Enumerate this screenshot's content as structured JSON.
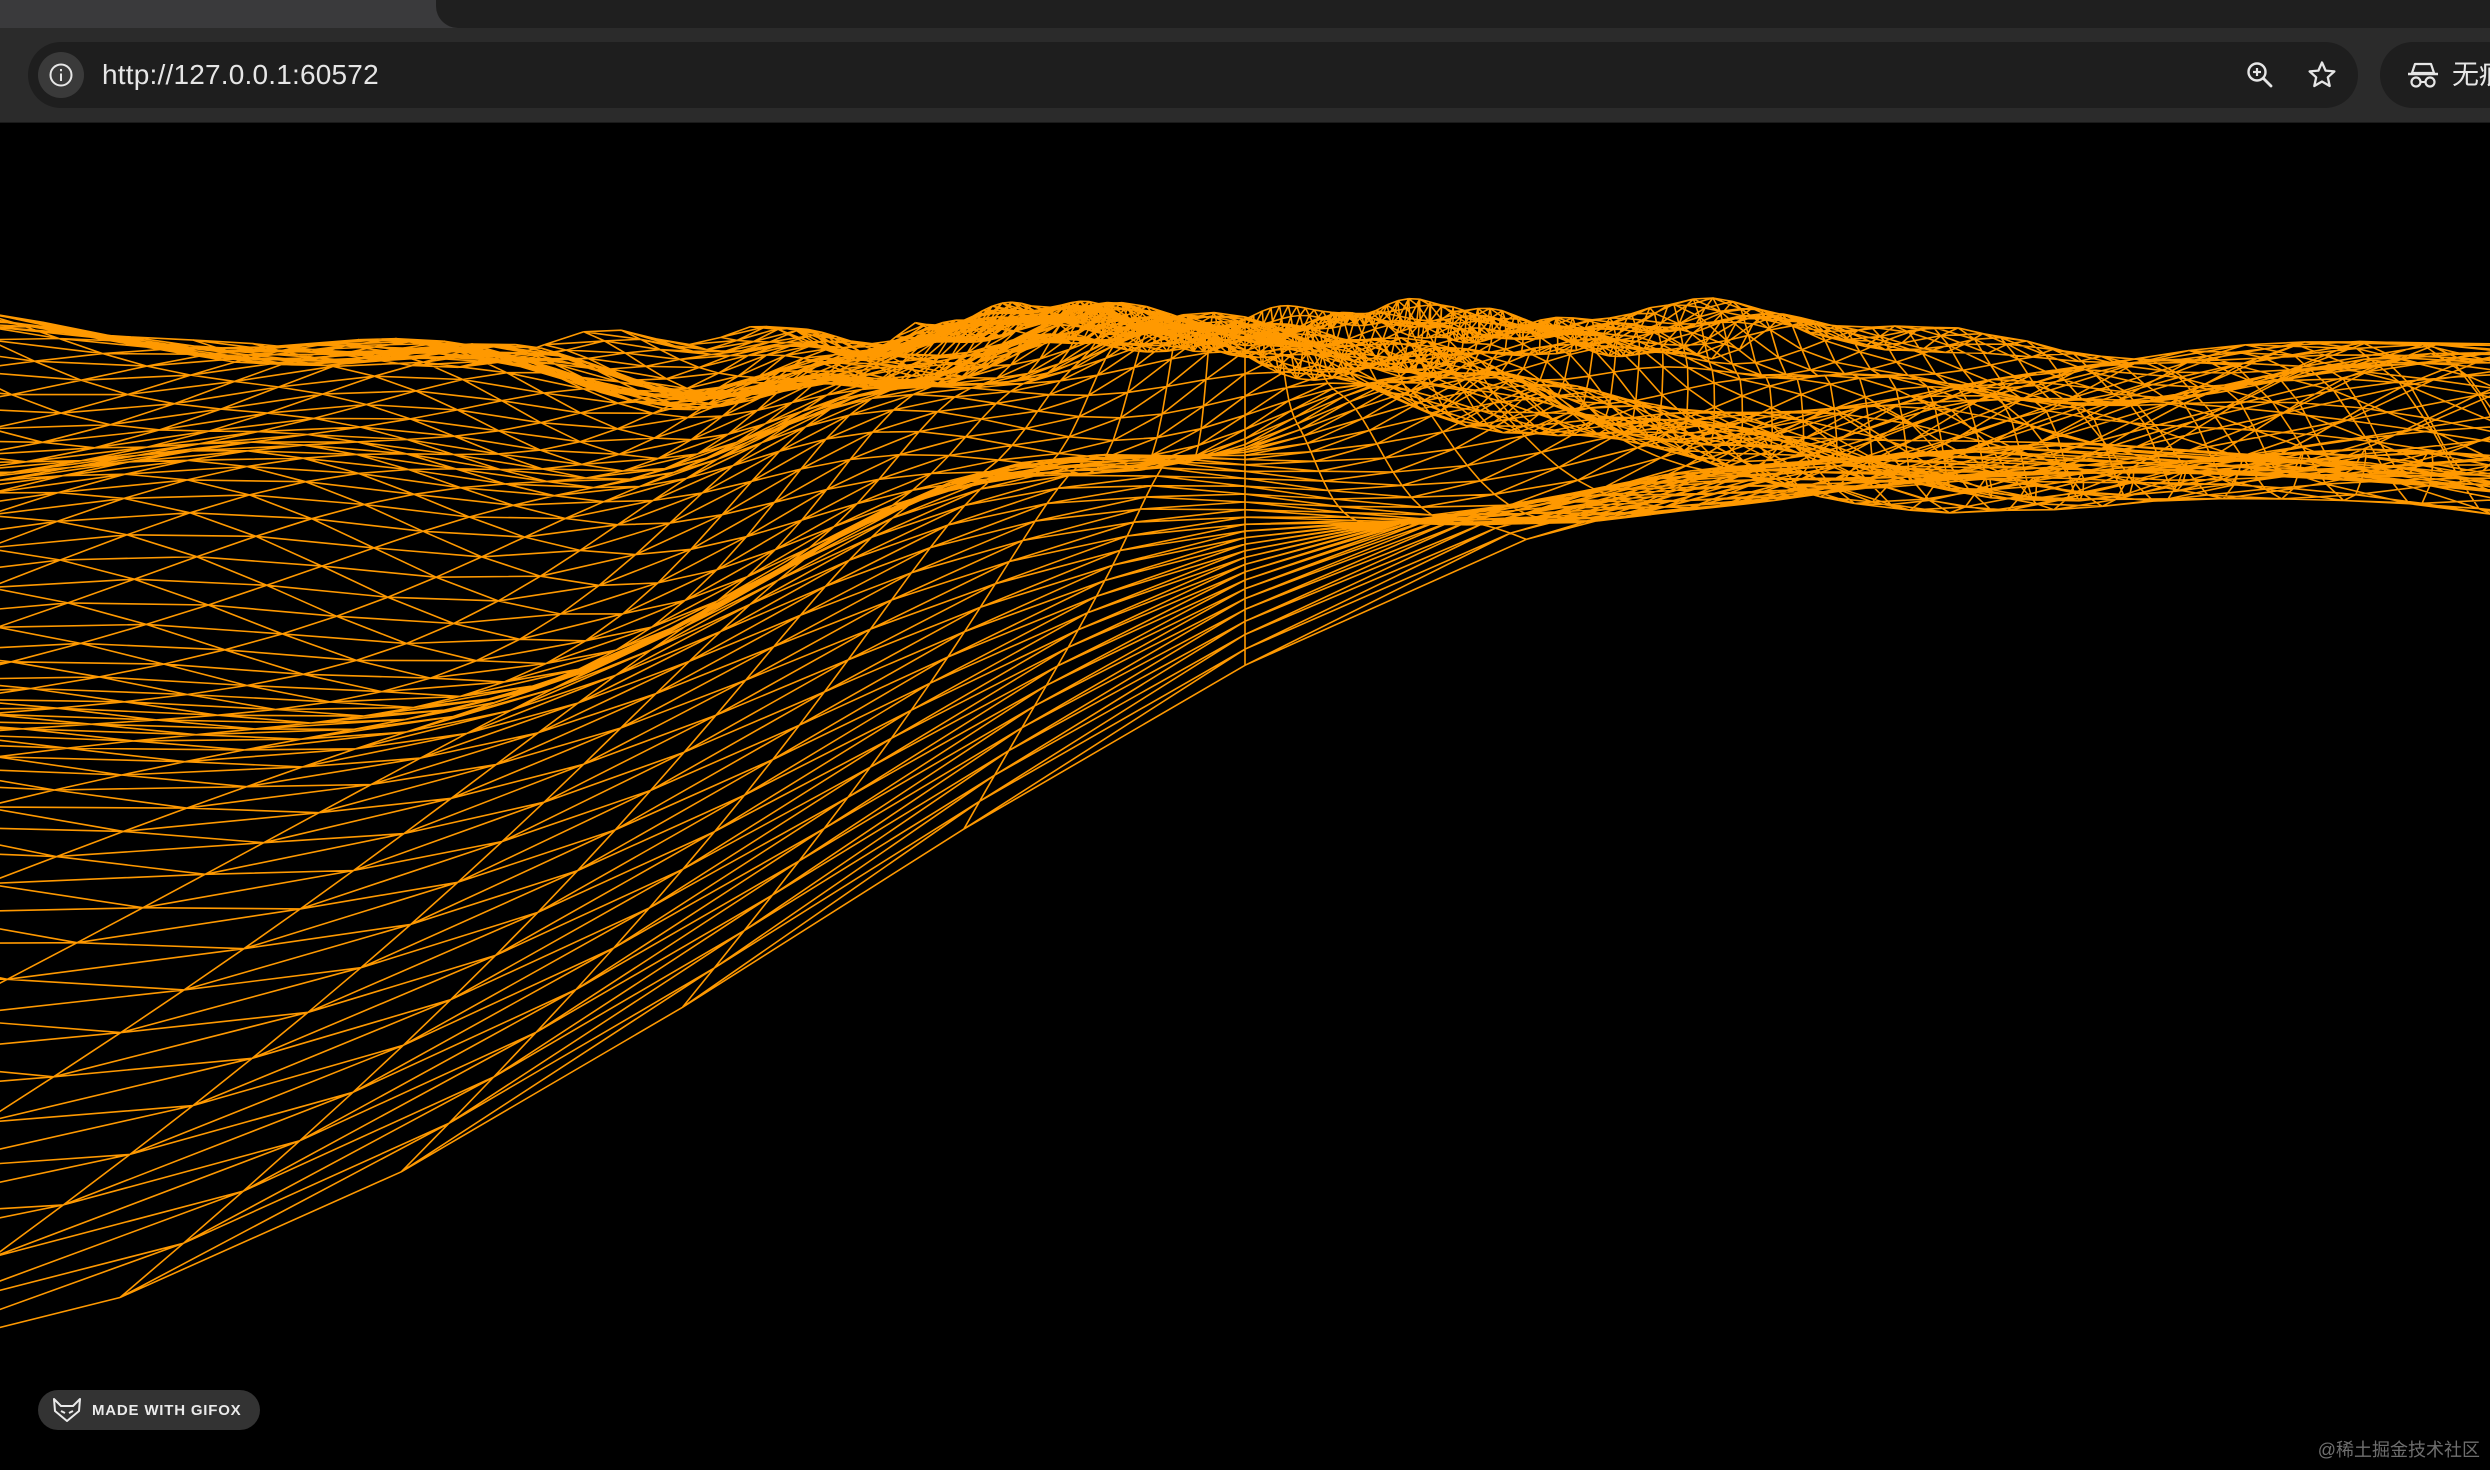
{
  "browser": {
    "url": "http://127.0.0.1:60572",
    "incognito_label": "无痕",
    "icons": {
      "site_info": "info-icon",
      "zoom": "zoom-in-icon",
      "bookmark": "star-icon",
      "incognito": "incognito-icon"
    }
  },
  "page": {
    "background_color": "#000000",
    "wireframe_color": "#ff9900",
    "badge_text": "MADE WITH GIFOX",
    "watermark_text": "@稀土掘金技术社区"
  }
}
